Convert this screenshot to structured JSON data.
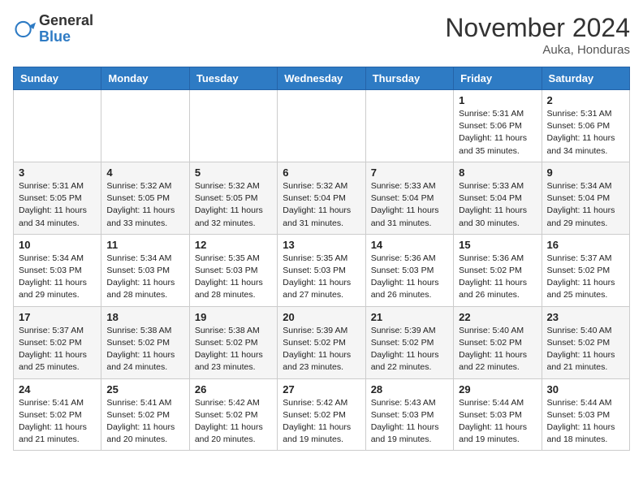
{
  "logo": {
    "general": "General",
    "blue": "Blue"
  },
  "header": {
    "month": "November 2024",
    "location": "Auka, Honduras"
  },
  "weekdays": [
    "Sunday",
    "Monday",
    "Tuesday",
    "Wednesday",
    "Thursday",
    "Friday",
    "Saturday"
  ],
  "weeks": [
    [
      {
        "day": "",
        "info": ""
      },
      {
        "day": "",
        "info": ""
      },
      {
        "day": "",
        "info": ""
      },
      {
        "day": "",
        "info": ""
      },
      {
        "day": "",
        "info": ""
      },
      {
        "day": "1",
        "info": "Sunrise: 5:31 AM\nSunset: 5:06 PM\nDaylight: 11 hours and 35 minutes."
      },
      {
        "day": "2",
        "info": "Sunrise: 5:31 AM\nSunset: 5:06 PM\nDaylight: 11 hours and 34 minutes."
      }
    ],
    [
      {
        "day": "3",
        "info": "Sunrise: 5:31 AM\nSunset: 5:05 PM\nDaylight: 11 hours and 34 minutes."
      },
      {
        "day": "4",
        "info": "Sunrise: 5:32 AM\nSunset: 5:05 PM\nDaylight: 11 hours and 33 minutes."
      },
      {
        "day": "5",
        "info": "Sunrise: 5:32 AM\nSunset: 5:05 PM\nDaylight: 11 hours and 32 minutes."
      },
      {
        "day": "6",
        "info": "Sunrise: 5:32 AM\nSunset: 5:04 PM\nDaylight: 11 hours and 31 minutes."
      },
      {
        "day": "7",
        "info": "Sunrise: 5:33 AM\nSunset: 5:04 PM\nDaylight: 11 hours and 31 minutes."
      },
      {
        "day": "8",
        "info": "Sunrise: 5:33 AM\nSunset: 5:04 PM\nDaylight: 11 hours and 30 minutes."
      },
      {
        "day": "9",
        "info": "Sunrise: 5:34 AM\nSunset: 5:04 PM\nDaylight: 11 hours and 29 minutes."
      }
    ],
    [
      {
        "day": "10",
        "info": "Sunrise: 5:34 AM\nSunset: 5:03 PM\nDaylight: 11 hours and 29 minutes."
      },
      {
        "day": "11",
        "info": "Sunrise: 5:34 AM\nSunset: 5:03 PM\nDaylight: 11 hours and 28 minutes."
      },
      {
        "day": "12",
        "info": "Sunrise: 5:35 AM\nSunset: 5:03 PM\nDaylight: 11 hours and 28 minutes."
      },
      {
        "day": "13",
        "info": "Sunrise: 5:35 AM\nSunset: 5:03 PM\nDaylight: 11 hours and 27 minutes."
      },
      {
        "day": "14",
        "info": "Sunrise: 5:36 AM\nSunset: 5:03 PM\nDaylight: 11 hours and 26 minutes."
      },
      {
        "day": "15",
        "info": "Sunrise: 5:36 AM\nSunset: 5:02 PM\nDaylight: 11 hours and 26 minutes."
      },
      {
        "day": "16",
        "info": "Sunrise: 5:37 AM\nSunset: 5:02 PM\nDaylight: 11 hours and 25 minutes."
      }
    ],
    [
      {
        "day": "17",
        "info": "Sunrise: 5:37 AM\nSunset: 5:02 PM\nDaylight: 11 hours and 25 minutes."
      },
      {
        "day": "18",
        "info": "Sunrise: 5:38 AM\nSunset: 5:02 PM\nDaylight: 11 hours and 24 minutes."
      },
      {
        "day": "19",
        "info": "Sunrise: 5:38 AM\nSunset: 5:02 PM\nDaylight: 11 hours and 23 minutes."
      },
      {
        "day": "20",
        "info": "Sunrise: 5:39 AM\nSunset: 5:02 PM\nDaylight: 11 hours and 23 minutes."
      },
      {
        "day": "21",
        "info": "Sunrise: 5:39 AM\nSunset: 5:02 PM\nDaylight: 11 hours and 22 minutes."
      },
      {
        "day": "22",
        "info": "Sunrise: 5:40 AM\nSunset: 5:02 PM\nDaylight: 11 hours and 22 minutes."
      },
      {
        "day": "23",
        "info": "Sunrise: 5:40 AM\nSunset: 5:02 PM\nDaylight: 11 hours and 21 minutes."
      }
    ],
    [
      {
        "day": "24",
        "info": "Sunrise: 5:41 AM\nSunset: 5:02 PM\nDaylight: 11 hours and 21 minutes."
      },
      {
        "day": "25",
        "info": "Sunrise: 5:41 AM\nSunset: 5:02 PM\nDaylight: 11 hours and 20 minutes."
      },
      {
        "day": "26",
        "info": "Sunrise: 5:42 AM\nSunset: 5:02 PM\nDaylight: 11 hours and 20 minutes."
      },
      {
        "day": "27",
        "info": "Sunrise: 5:42 AM\nSunset: 5:02 PM\nDaylight: 11 hours and 19 minutes."
      },
      {
        "day": "28",
        "info": "Sunrise: 5:43 AM\nSunset: 5:03 PM\nDaylight: 11 hours and 19 minutes."
      },
      {
        "day": "29",
        "info": "Sunrise: 5:44 AM\nSunset: 5:03 PM\nDaylight: 11 hours and 19 minutes."
      },
      {
        "day": "30",
        "info": "Sunrise: 5:44 AM\nSunset: 5:03 PM\nDaylight: 11 hours and 18 minutes."
      }
    ]
  ]
}
